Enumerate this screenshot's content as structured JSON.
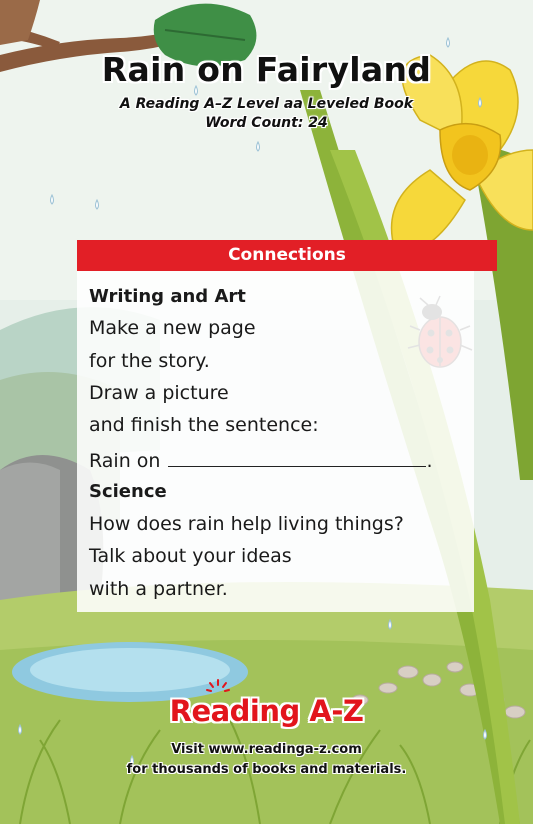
{
  "cover": {
    "title": "Rain on Fairyland",
    "subtitle": "A Reading A–Z Level aa Leveled Book",
    "word_count": "Word Count: 24"
  },
  "connections": {
    "header": "Connections",
    "writing_heading": "Writing and Art",
    "writing_lines": [
      "Make a new page",
      "for the story.",
      "Draw a picture",
      "and finish the sentence:"
    ],
    "sentence_start": "Rain on",
    "sentence_end": ".",
    "science_heading": "Science",
    "science_lines": [
      "How does rain help living things?",
      "Talk about your ideas",
      "with a partner."
    ]
  },
  "footer": {
    "logo": "Reading A-Z",
    "visit_prefix": "Visit",
    "url": "www.readinga-z.com",
    "tagline": "for thousands of books and materials."
  },
  "colors": {
    "header_red": "#e21f26",
    "logo_red": "#e2151c",
    "daffodil_yellow": "#f6d83a",
    "leaf_green": "#8fb23a"
  }
}
